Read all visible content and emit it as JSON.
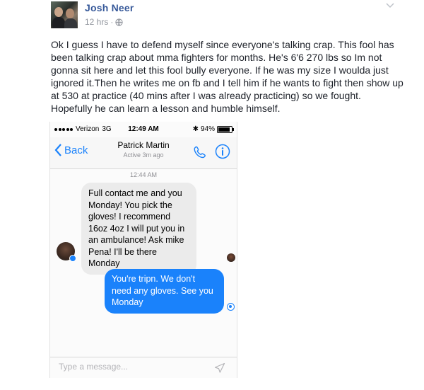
{
  "post": {
    "author": "Josh Neer",
    "time": "12 hrs",
    "separator": "·",
    "text": "Ok I guess I have to defend myself since everyone's talking crap. This fool has been talking crap about mma fighters for months. He's 6'6 270 lbs so Im not gonna sit here and let this fool bully everyone. If he was my size I woulda just ignored it.Then he writes me on fb and I tell him if he wants to fight then show up at 530 at practice (40 mins after I was already practicing) so we fought. Hopefully he can learn a lesson and humble himself."
  },
  "phone": {
    "status": {
      "carrier": "Verizon",
      "network": "3G",
      "time": "12:49 AM",
      "battery": "94%"
    },
    "nav": {
      "back_label": "Back",
      "contact_name": "Patrick Martin",
      "contact_status": "Active 3m ago"
    },
    "conversation": {
      "timestamp": "12:44 AM",
      "incoming": "Full contact me and you Monday! You pick the gloves! I recommend 16oz 4oz I will put you in an ambulance! Ask mike Pena! I'll be there Monday",
      "outgoing": "You're tripn. We don't need any gloves. See you Monday"
    },
    "composer": {
      "placeholder": "Type a message..."
    }
  },
  "icons": {
    "post_menu": "chevron-down-icon",
    "privacy": "globe-icon",
    "back": "chevron-left-icon",
    "call": "phone-icon",
    "info": "info-icon",
    "send": "send-icon"
  },
  "colors": {
    "fb_link": "#365899",
    "messenger_blue": "#1a82fb",
    "bubble_gray": "#ebebeb"
  }
}
